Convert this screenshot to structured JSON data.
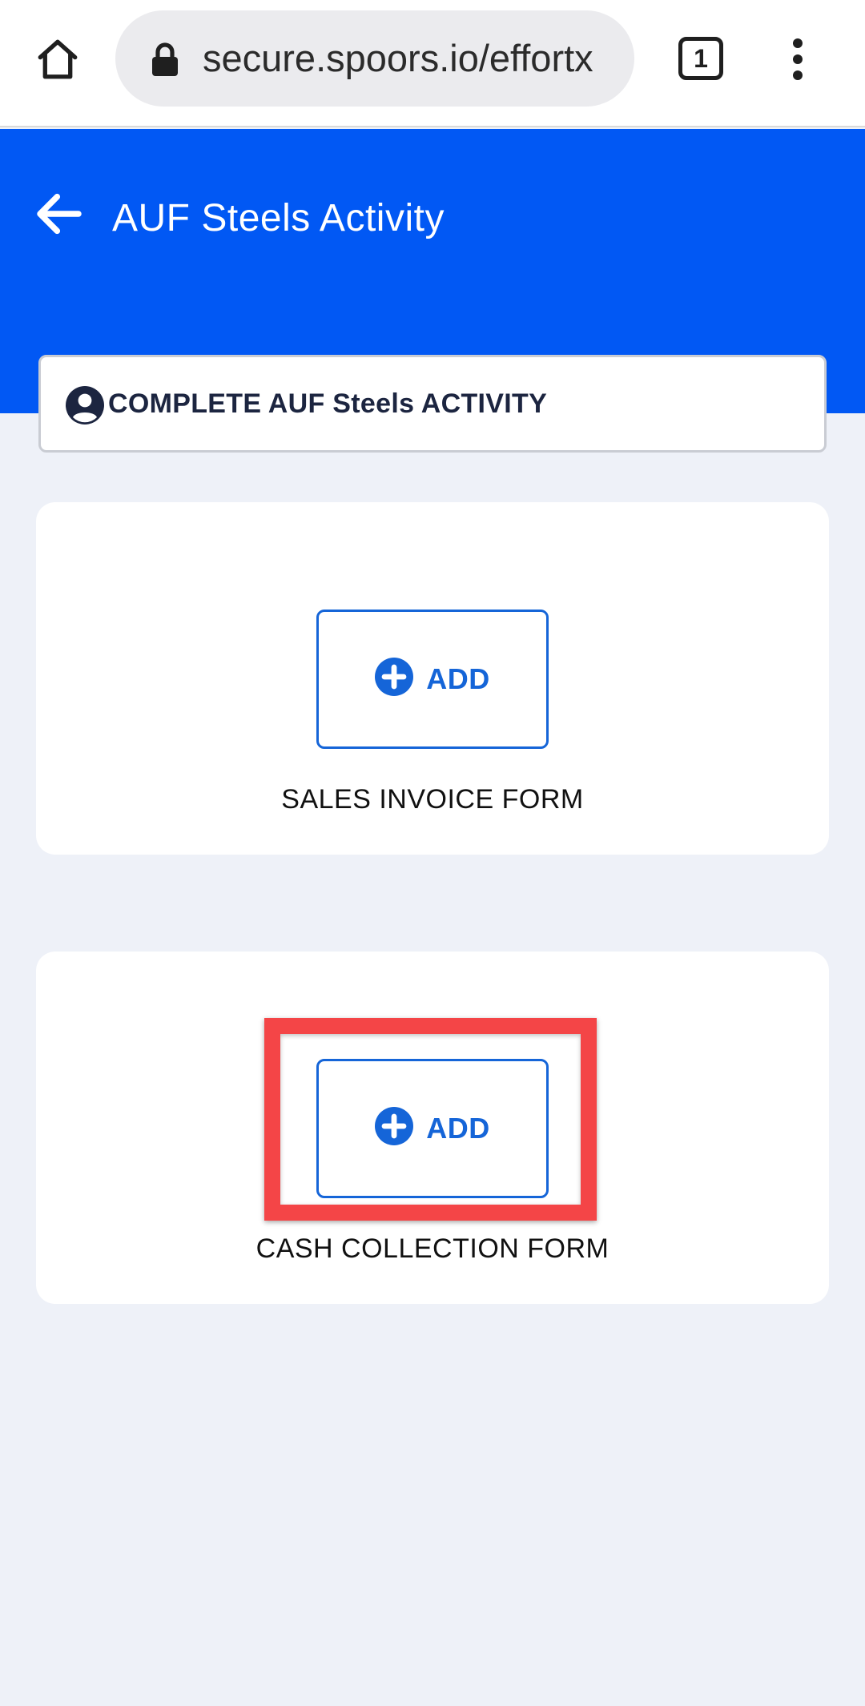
{
  "browser": {
    "url": "secure.spoors.io/effortx",
    "tab_count": "1",
    "icons": [
      "home-icon",
      "lock-icon",
      "tab-switcher-icon",
      "more-vert-icon"
    ]
  },
  "header": {
    "title": "AUF Steels Activity",
    "background_color": "#0158f4",
    "back_icon": "arrow-left-icon"
  },
  "activity": {
    "label": "COMPLETE AUF Steels ACTIVITY",
    "icon": "user-circle-icon"
  },
  "forms": [
    {
      "add_label": "ADD",
      "form_name": "SALES INVOICE FORM",
      "icon": "plus-circle-icon"
    },
    {
      "add_label": "ADD",
      "form_name": "CASH COLLECTION FORM",
      "icon": "plus-circle-icon",
      "highlighted": true
    }
  ],
  "colors": {
    "accent": "#1565d8",
    "highlight": "#f44547",
    "page_background": "#eef1f8"
  }
}
